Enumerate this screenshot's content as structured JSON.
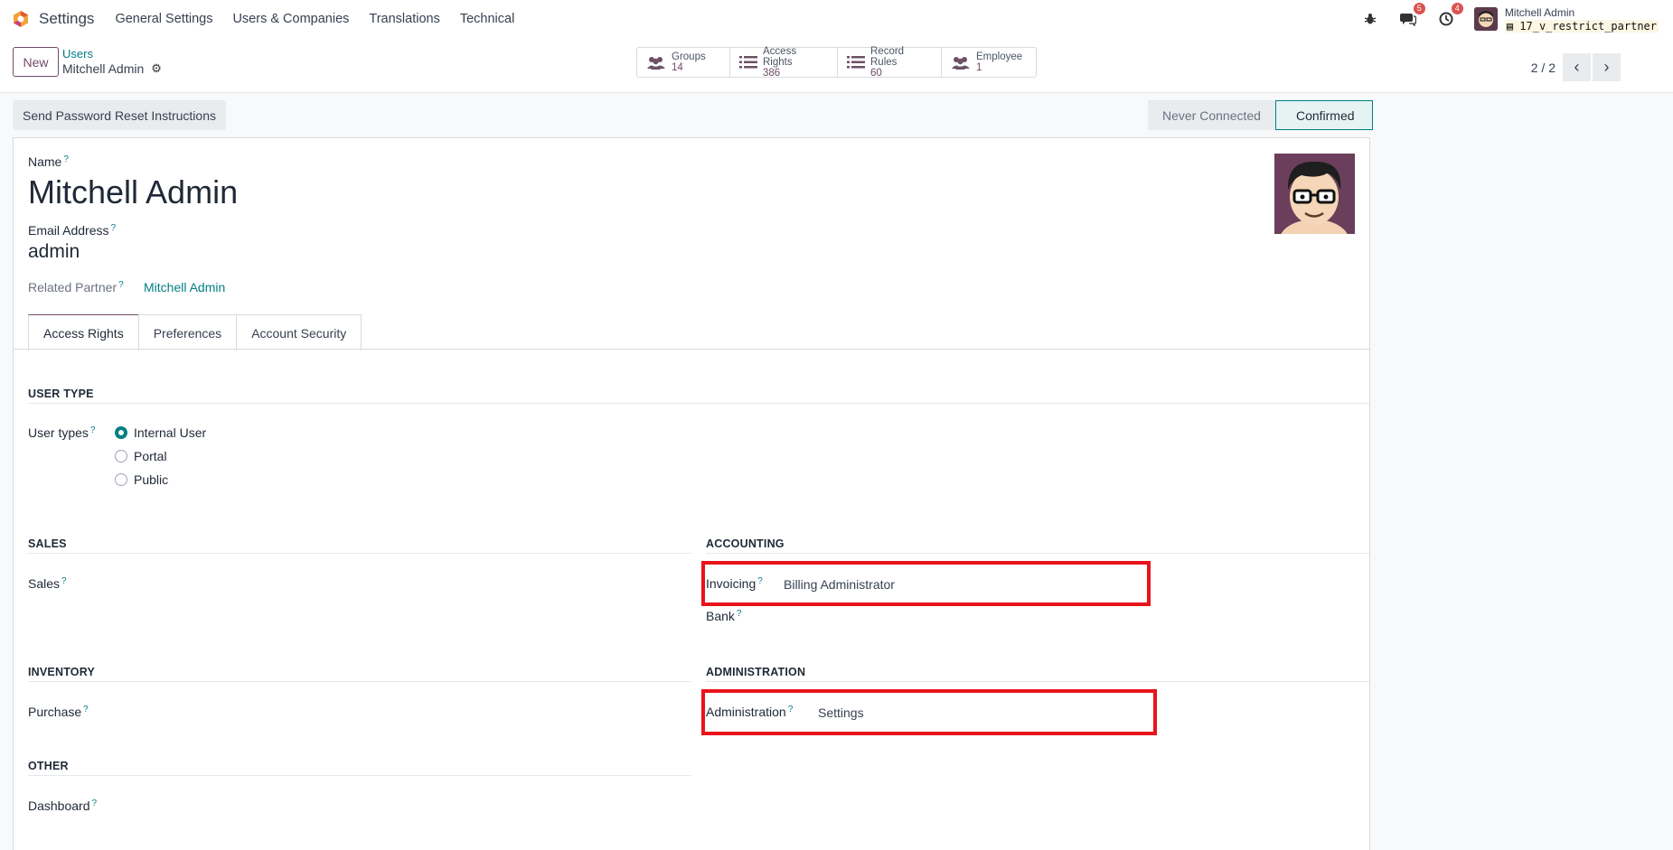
{
  "navbar": {
    "app_name": "Settings",
    "menu": [
      "General Settings",
      "Users & Companies",
      "Translations",
      "Technical"
    ],
    "messages_badge": "5",
    "activities_badge": "4",
    "user_name": "Mitchell Admin",
    "database": "17_v_restrict_partner"
  },
  "control": {
    "new_label": "New",
    "breadcrumb_parent": "Users",
    "breadcrumb_current": "Mitchell Admin",
    "smart_buttons": [
      {
        "label": "Groups",
        "value": "14",
        "icon": "users-icon"
      },
      {
        "label": "Access Rights",
        "value": "386",
        "icon": "list-icon"
      },
      {
        "label": "Record Rules",
        "value": "60",
        "icon": "list-icon"
      },
      {
        "label": "Employee",
        "value": "1",
        "icon": "users-icon"
      }
    ],
    "pager": "2 / 2"
  },
  "statusbar": {
    "reset_button": "Send Password Reset Instructions",
    "stages": [
      "Never Connected",
      "Confirmed"
    ],
    "active_stage": "Confirmed"
  },
  "form": {
    "name_label": "Name",
    "name_value": "Mitchell Admin",
    "email_label": "Email Address",
    "email_value": "admin",
    "partner_label": "Related Partner",
    "partner_value": "Mitchell Admin",
    "help_mark": "?",
    "tabs": [
      "Access Rights",
      "Preferences",
      "Account Security"
    ],
    "active_tab": "Access Rights",
    "user_type_section": "USER TYPE",
    "user_types_label": "User types",
    "user_type_options": [
      "Internal User",
      "Portal",
      "Public"
    ],
    "user_type_selected": "Internal User",
    "sales_section": "SALES",
    "sales_label": "Sales",
    "accounting_section": "ACCOUNTING",
    "invoicing_label": "Invoicing",
    "invoicing_value": "Billing Administrator",
    "bank_label": "Bank",
    "inventory_section": "INVENTORY",
    "purchase_label": "Purchase",
    "administration_section": "ADMINISTRATION",
    "administration_label": "Administration",
    "administration_value": "Settings",
    "other_section": "OTHER",
    "dashboard_label": "Dashboard"
  },
  "colors": {
    "brand": "#714b67",
    "accent": "#017e84",
    "highlight": "#e8141c"
  }
}
